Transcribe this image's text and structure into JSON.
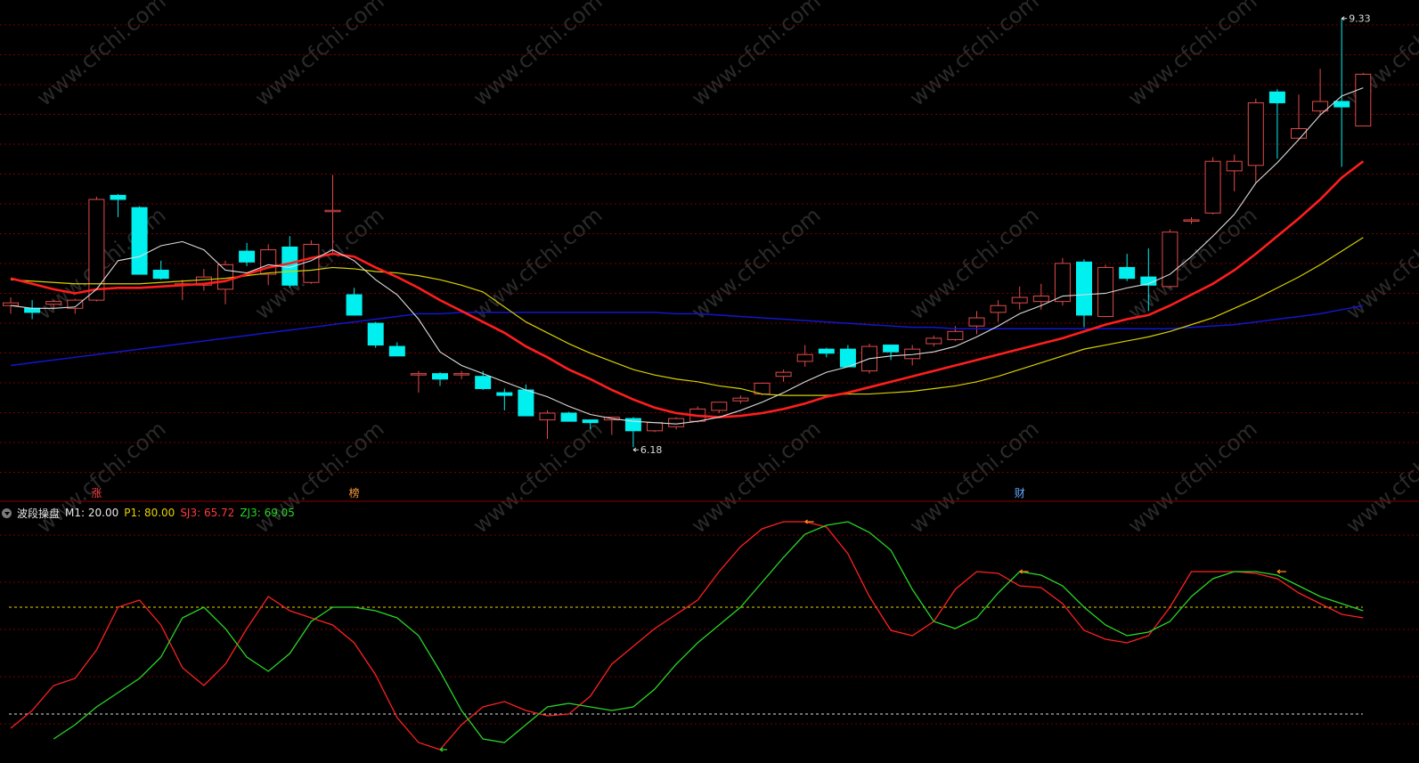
{
  "indicator": {
    "name": "波段操盘",
    "params": [
      {
        "label": "M1: 20.00",
        "color": "#e8e8e8"
      },
      {
        "label": "P1: 80.00",
        "color": "#e6d200"
      },
      {
        "label": "SJ3: 65.72",
        "color": "#ff3b3b"
      },
      {
        "label": "ZJ3: 69.05",
        "color": "#28d628"
      }
    ]
  },
  "price_labels": {
    "high": "9.33",
    "low": "6.18"
  },
  "signals": [
    {
      "text": "涨",
      "index": 4,
      "color": "#ff4040"
    },
    {
      "text": "榜",
      "index": 16,
      "color": "#ff9a3a"
    },
    {
      "text": "财",
      "index": 47,
      "color": "#66aaff"
    }
  ],
  "colors": {
    "up": "#e24a4a",
    "down": "#00f0f0",
    "ma5": "#dcdcdc",
    "ma10": "#ff1e1e",
    "ma20": "#d8d000",
    "ma60": "#1515cc",
    "grid": "#7a0000",
    "divider": "#8a0000"
  },
  "chart_data": [
    {
      "type": "candlestick",
      "title": "",
      "ylim": [
        5.9,
        9.4
      ],
      "candles": [
        [
          7.22,
          7.24,
          7.16,
          7.28
        ],
        [
          7.2,
          7.17,
          7.12,
          7.26
        ],
        [
          7.23,
          7.25,
          7.19,
          7.26
        ],
        [
          7.2,
          7.26,
          7.16,
          7.27
        ],
        [
          7.26,
          8.0,
          7.25,
          8.02
        ],
        [
          8.03,
          8.0,
          7.87,
          8.04
        ],
        [
          7.94,
          7.45,
          7.45,
          7.95
        ],
        [
          7.48,
          7.42,
          7.41,
          7.55
        ],
        [
          7.37,
          7.38,
          7.26,
          7.41
        ],
        [
          7.37,
          7.43,
          7.33,
          7.49
        ],
        [
          7.34,
          7.52,
          7.23,
          7.55
        ],
        [
          7.62,
          7.54,
          7.51,
          7.68
        ],
        [
          7.45,
          7.63,
          7.37,
          7.67
        ],
        [
          7.65,
          7.37,
          7.35,
          7.73
        ],
        [
          7.39,
          7.67,
          7.38,
          7.7
        ],
        [
          7.91,
          7.92,
          7.59,
          8.18
        ],
        [
          7.3,
          7.15,
          7.15,
          7.35
        ],
        [
          7.09,
          6.93,
          6.91,
          7.1
        ],
        [
          6.92,
          6.85,
          6.85,
          6.95
        ],
        [
          6.71,
          6.72,
          6.58,
          6.74
        ],
        [
          6.72,
          6.68,
          6.63,
          6.73
        ],
        [
          6.72,
          6.72,
          6.68,
          6.74
        ],
        [
          6.7,
          6.61,
          6.6,
          6.74
        ],
        [
          6.58,
          6.56,
          6.45,
          6.61
        ],
        [
          6.6,
          6.41,
          6.41,
          6.64
        ],
        [
          6.38,
          6.43,
          6.24,
          6.45
        ],
        [
          6.43,
          6.37,
          6.37,
          6.44
        ],
        [
          6.38,
          6.36,
          6.31,
          6.38
        ],
        [
          6.38,
          6.4,
          6.27,
          6.4
        ],
        [
          6.39,
          6.3,
          6.18,
          6.4
        ],
        [
          6.3,
          6.36,
          6.29,
          6.36
        ],
        [
          6.33,
          6.39,
          6.31,
          6.4
        ],
        [
          6.37,
          6.46,
          6.36,
          6.48
        ],
        [
          6.45,
          6.51,
          6.43,
          6.51
        ],
        [
          6.52,
          6.54,
          6.5,
          6.56
        ],
        [
          6.57,
          6.65,
          6.56,
          6.65
        ],
        [
          6.7,
          6.73,
          6.66,
          6.75
        ],
        [
          6.81,
          6.86,
          6.77,
          6.93
        ],
        [
          6.9,
          6.87,
          6.84,
          6.91
        ],
        [
          6.9,
          6.77,
          6.77,
          6.93
        ],
        [
          6.74,
          6.92,
          6.72,
          6.94
        ],
        [
          6.93,
          6.88,
          6.82,
          6.93
        ],
        [
          6.83,
          6.9,
          6.78,
          6.93
        ],
        [
          6.94,
          6.98,
          6.92,
          7.0
        ],
        [
          6.97,
          7.03,
          6.96,
          7.07
        ],
        [
          7.07,
          7.13,
          7.01,
          7.18
        ],
        [
          7.17,
          7.22,
          7.1,
          7.26
        ],
        [
          7.24,
          7.28,
          7.19,
          7.36
        ],
        [
          7.25,
          7.29,
          7.19,
          7.38
        ],
        [
          7.25,
          7.53,
          7.22,
          7.57
        ],
        [
          7.54,
          7.15,
          7.06,
          7.56
        ],
        [
          7.14,
          7.5,
          7.14,
          7.52
        ],
        [
          7.5,
          7.42,
          7.4,
          7.6
        ],
        [
          7.43,
          7.37,
          7.18,
          7.64
        ],
        [
          7.36,
          7.76,
          7.35,
          7.78
        ],
        [
          7.85,
          7.85,
          7.82,
          7.87
        ],
        [
          7.9,
          8.28,
          7.89,
          8.31
        ],
        [
          8.21,
          8.28,
          8.06,
          8.33
        ],
        [
          8.25,
          8.71,
          8.12,
          8.74
        ],
        [
          8.79,
          8.71,
          8.3,
          8.81
        ],
        [
          8.45,
          8.52,
          8.47,
          8.77
        ],
        [
          8.65,
          8.72,
          8.62,
          8.96
        ],
        [
          8.72,
          8.68,
          8.24,
          9.33
        ],
        [
          8.54,
          8.92,
          8.54,
          8.93
        ]
      ],
      "series": [
        {
          "key": "ma5",
          "values": [
            7.22,
            7.2,
            7.2,
            7.21,
            7.34,
            7.55,
            7.58,
            7.66,
            7.69,
            7.63,
            7.48,
            7.46,
            7.52,
            7.5,
            7.55,
            7.63,
            7.55,
            7.41,
            7.3,
            7.12,
            6.88,
            6.78,
            6.72,
            6.66,
            6.6,
            6.55,
            6.48,
            6.42,
            6.39,
            6.37,
            6.36,
            6.35,
            6.37,
            6.4,
            6.45,
            6.51,
            6.58,
            6.66,
            6.73,
            6.77,
            6.83,
            6.85,
            6.86,
            6.88,
            6.92,
            6.99,
            7.07,
            7.16,
            7.22,
            7.29,
            7.3,
            7.31,
            7.35,
            7.38,
            7.45,
            7.58,
            7.73,
            7.89,
            8.12,
            8.27,
            8.44,
            8.62,
            8.76,
            8.82
          ]
        },
        {
          "key": "ma10",
          "values": [
            7.42,
            7.38,
            7.34,
            7.31,
            7.34,
            7.35,
            7.35,
            7.36,
            7.37,
            7.38,
            7.4,
            7.45,
            7.5,
            7.53,
            7.57,
            7.6,
            7.58,
            7.5,
            7.43,
            7.35,
            7.26,
            7.18,
            7.1,
            7.02,
            6.92,
            6.84,
            6.75,
            6.68,
            6.6,
            6.53,
            6.47,
            6.43,
            6.41,
            6.4,
            6.41,
            6.43,
            6.46,
            6.5,
            6.55,
            6.58,
            6.62,
            6.66,
            6.7,
            6.74,
            6.78,
            6.82,
            6.86,
            6.9,
            6.94,
            6.98,
            7.03,
            7.08,
            7.12,
            7.15,
            7.22,
            7.3,
            7.38,
            7.48,
            7.6,
            7.73,
            7.86,
            8.0,
            8.16,
            8.28
          ]
        },
        {
          "key": "ma20",
          "values": [
            7.41,
            7.4,
            7.39,
            7.38,
            7.38,
            7.38,
            7.38,
            7.39,
            7.4,
            7.41,
            7.42,
            7.44,
            7.46,
            7.47,
            7.48,
            7.5,
            7.49,
            7.47,
            7.46,
            7.44,
            7.41,
            7.37,
            7.32,
            7.21,
            7.1,
            7.02,
            6.94,
            6.87,
            6.81,
            6.75,
            6.71,
            6.68,
            6.66,
            6.63,
            6.61,
            6.57,
            6.56,
            6.56,
            6.56,
            6.57,
            6.57,
            6.58,
            6.59,
            6.61,
            6.63,
            6.66,
            6.7,
            6.75,
            6.8,
            6.85,
            6.9,
            6.93,
            6.96,
            6.99,
            7.03,
            7.08,
            7.13,
            7.2,
            7.27,
            7.35,
            7.43,
            7.52,
            7.62,
            7.72
          ]
        },
        {
          "key": "ma60",
          "values": [
            6.78,
            6.8,
            6.82,
            6.84,
            6.86,
            6.88,
            6.9,
            6.92,
            6.94,
            6.96,
            6.98,
            7.0,
            7.02,
            7.04,
            7.06,
            7.08,
            7.1,
            7.12,
            7.14,
            7.16,
            7.16,
            7.17,
            7.17,
            7.17,
            7.17,
            7.17,
            7.17,
            7.17,
            7.17,
            7.17,
            7.17,
            7.16,
            7.16,
            7.15,
            7.14,
            7.13,
            7.12,
            7.11,
            7.1,
            7.09,
            7.08,
            7.07,
            7.06,
            7.06,
            7.05,
            7.05,
            7.05,
            7.05,
            7.05,
            7.05,
            7.05,
            7.05,
            7.05,
            7.05,
            7.05,
            7.06,
            7.07,
            7.08,
            7.1,
            7.12,
            7.14,
            7.16,
            7.19,
            7.22
          ]
        }
      ]
    },
    {
      "type": "line",
      "title": "",
      "ylim": [
        -5,
        125
      ],
      "reference_lines": [
        20,
        80
      ],
      "series": [
        {
          "key": "SJ3",
          "color": "#ff2020",
          "values": [
            12,
            22,
            36,
            40,
            56,
            80,
            84,
            70,
            46,
            36,
            48,
            68,
            86,
            78,
            74,
            70,
            60,
            42,
            18,
            4,
            0,
            14,
            24,
            27,
            22,
            19,
            20,
            30,
            48,
            58,
            68,
            76,
            84,
            100,
            114,
            124,
            128,
            128,
            125,
            110,
            86,
            67,
            64,
            72,
            90,
            100,
            99,
            92,
            91,
            82,
            67,
            62,
            60,
            64,
            80,
            100,
            100,
            100,
            99,
            96,
            88,
            82,
            76,
            74
          ]
        },
        {
          "key": "ZJ3",
          "color": "#28d628",
          "values": [
            6,
            14,
            24,
            32,
            40,
            52,
            74,
            80,
            68,
            52,
            44,
            54,
            72,
            80,
            80,
            78,
            74,
            64,
            44,
            22,
            6,
            4,
            14,
            24,
            26,
            24,
            22,
            24,
            34,
            48,
            60,
            70,
            80,
            94,
            108,
            121,
            126,
            128,
            122,
            112,
            90,
            72,
            68,
            74,
            88,
            100,
            98,
            92,
            80,
            70,
            64,
            66,
            72,
            86,
            96,
            100,
            100,
            98,
            92,
            86,
            82,
            78
          ]
        },
        {
          "key": "signals",
          "values": []
        }
      ]
    }
  ],
  "buy_signal": {
    "index": 20,
    "value": 0
  },
  "sell_signals": [
    {
      "index": 37,
      "value": 128
    },
    {
      "index": 47,
      "value": 100
    },
    {
      "index": 59,
      "value": 100
    }
  ]
}
